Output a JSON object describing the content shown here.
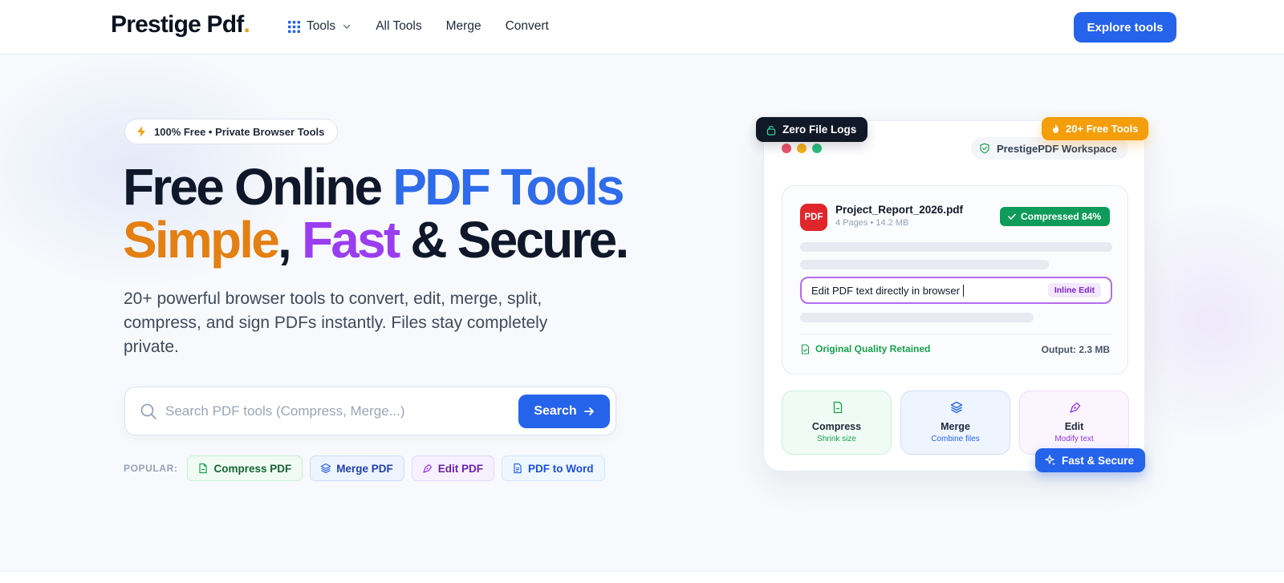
{
  "header": {
    "logo_text": "Prestige Pdf",
    "logo_dot": ".",
    "nav": {
      "tools": "Tools",
      "all_tools": "All Tools",
      "merge": "Merge",
      "convert": "Convert"
    },
    "cta_label": "Explore tools"
  },
  "hero": {
    "badge": "100% Free • Private Browser Tools",
    "headline": {
      "line1_dark": "Free Online ",
      "line1_blue": "PDF Tools",
      "line2_orange": "Simple",
      "line2_comma": ", ",
      "line2_purple": "Fast",
      "line2_dark": " & Secure."
    },
    "subtext": "20+ powerful browser tools to convert, edit, merge, split, compress, and sign PDFs instantly. Files stay completely private.",
    "search": {
      "placeholder": "Search PDF tools (Compress, Merge...)",
      "value": "",
      "button_label": "Search"
    },
    "popular": {
      "label": "POPULAR:",
      "chips": [
        "Compress PDF",
        "Merge PDF",
        "Edit PDF",
        "PDF to Word"
      ]
    }
  },
  "mockup": {
    "tag_zero_logs": "Zero File Logs",
    "tag_free_tools": "20+ Free Tools",
    "workspace_label": "PrestigePDF Workspace",
    "file": {
      "icon_text": "PDF",
      "name": "Project_Report_2026.pdf",
      "meta": "4 Pages • 14.2 MB",
      "status": "Compressed 84%"
    },
    "edit_field": {
      "text": "Edit PDF text directly in browser",
      "badge": "Inline Edit"
    },
    "quality": "Original Quality Retained",
    "output": "Output: 2.3 MB",
    "tiles": [
      {
        "title": "Compress",
        "sub": "Shrink size"
      },
      {
        "title": "Merge",
        "sub": "Combine files"
      },
      {
        "title": "Edit",
        "sub": "Modify text"
      }
    ],
    "fast_badge": "Fast & Secure"
  },
  "colors": {
    "accent_blue": "#2563eb",
    "headline_blue": "#2f6bea",
    "headline_orange": "#e47f12",
    "headline_purple": "#9a3df0",
    "free_tag": "#f59e0b",
    "compressed_green": "#0f9b5a",
    "pdf_red": "#e0262b"
  },
  "icons": {
    "nav_tools": "grid-icon",
    "nav_chevron": "chevron-down-icon",
    "badge": "bolt-icon",
    "search": "search-icon",
    "search_button": "arrow-right-icon",
    "chips": [
      "file-icon",
      "layers-icon",
      "pen-tool-icon",
      "file-text-icon"
    ],
    "zero_logs": "lock-icon",
    "free_tools": "flame-icon",
    "workspace": "shield-check-icon",
    "compressed": "check-icon",
    "quality": "file-check-icon",
    "fast": "sparkles-icon"
  }
}
